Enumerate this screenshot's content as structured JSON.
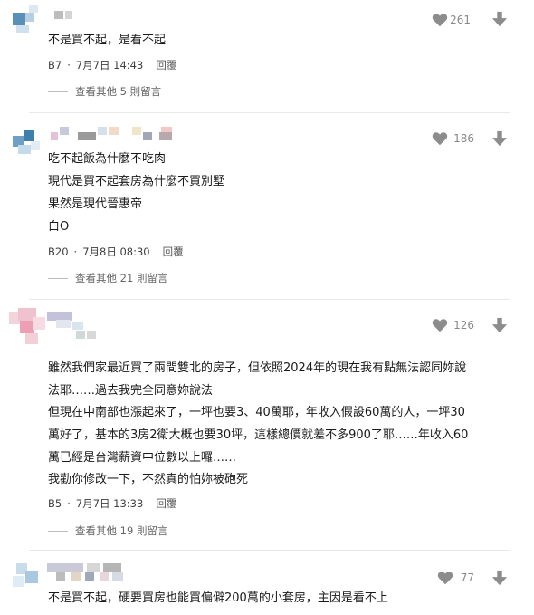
{
  "colors": {
    "icon_gray": "#8c8c8c",
    "text": "#1a1a1a",
    "meta": "#404040"
  },
  "comments": [
    {
      "lines": [
        "不是買不起，是看不起"
      ],
      "floor": "B7",
      "date": "7月7日 14:43",
      "reply_label": "回覆",
      "view_more": "查看其他 5 則留言",
      "likes": "261"
    },
    {
      "lines": [
        "吃不起飯為什麼不吃肉",
        "現代是買不起套房為什麼不買別墅",
        "果然是現代晉惠帝",
        "白O"
      ],
      "floor": "B20",
      "date": "7月8日 08:30",
      "reply_label": "回覆",
      "view_more": "查看其他 21 則留言",
      "likes": "186"
    },
    {
      "lines": [
        "雖然我們家最近買了兩間雙北的房子，但依照2024年的現在我有點無法認同妳說",
        "法耶……過去我完全同意妳說法",
        "但現在中南部也漲起來了，一坪也要3、40萬耶，年收入假設60萬的人，一坪30",
        "萬好了，基本的3房2衛大概也要30坪，這樣總價就差不多900了耶……年收入60",
        "萬已經是台灣薪資中位數以上囉……",
        "我勸你修改一下，不然真的怕妳被砲死"
      ],
      "floor": "B5",
      "date": "7月7日 13:33",
      "reply_label": "回覆",
      "view_more": "查看其他 19 則留言",
      "likes": "126"
    },
    {
      "lines": [
        "不是買不起，硬要買房也能買偏僻200萬的小套房，主因是看不上"
      ],
      "likes": "77"
    }
  ]
}
